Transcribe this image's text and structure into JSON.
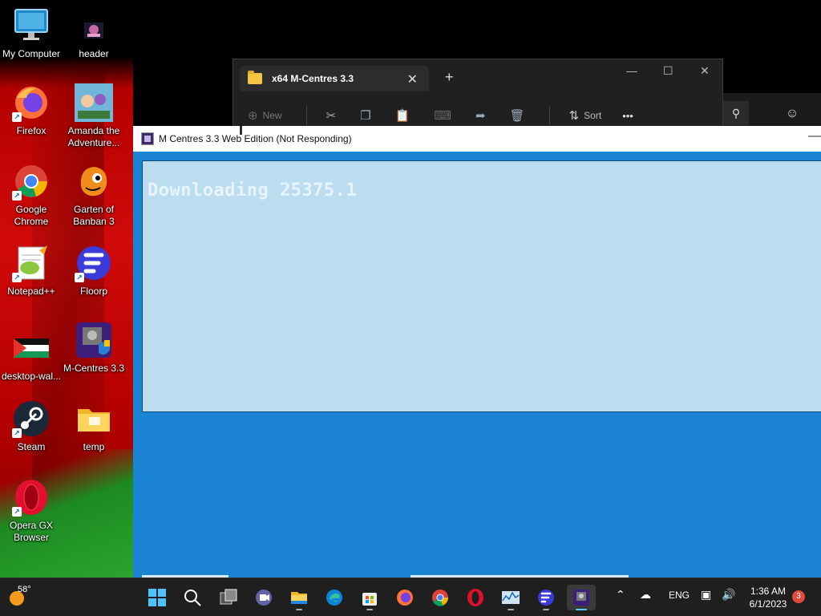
{
  "desktop": {
    "icons": [
      {
        "label": "My Computer",
        "icon": "monitor-icon"
      },
      {
        "label": "header",
        "icon": "image-icon"
      },
      {
        "label": "Firefox",
        "icon": "firefox-icon"
      },
      {
        "label": "Amanda the Adventure...",
        "icon": "game-icon"
      },
      {
        "label": "Google Chrome",
        "icon": "chrome-icon"
      },
      {
        "label": "Garten of Banban 3",
        "icon": "game-icon"
      },
      {
        "label": "Notepad++",
        "icon": "notepad-icon"
      },
      {
        "label": "Floorp",
        "icon": "floorp-icon"
      },
      {
        "label": "desktop-wal...",
        "icon": "image-icon"
      },
      {
        "label": "M-Centres 3.3",
        "icon": "mcentres-icon"
      },
      {
        "label": "Steam",
        "icon": "steam-icon"
      },
      {
        "label": "temp",
        "icon": "folder-icon"
      },
      {
        "label": "Opera GX Browser",
        "icon": "opera-icon"
      }
    ]
  },
  "explorer": {
    "tab_title": "x64 M-Centres 3.3",
    "new_tab": "+",
    "toolbar": {
      "new_label": "New",
      "sort_label": "Sort",
      "more": "•••"
    }
  },
  "app": {
    "title": "M Centres 3.3 Web Edition (Not Responding)",
    "status_text": "Downloading 25375.1"
  },
  "taskbar": {
    "weather_temp": "58°",
    "language": "ENG",
    "time": "1:36 AM",
    "date": "6/1/2023",
    "notification_count": "3",
    "apps": [
      "start",
      "search",
      "task-view",
      "chat",
      "file-explorer",
      "edge",
      "store",
      "firefox",
      "chrome",
      "opera",
      "monitor",
      "floorp",
      "m-centres"
    ]
  },
  "colors": {
    "app_bg": "#1c84d4",
    "panel_bg": "#bcdcf0",
    "taskbar": "#1f1f1f"
  }
}
